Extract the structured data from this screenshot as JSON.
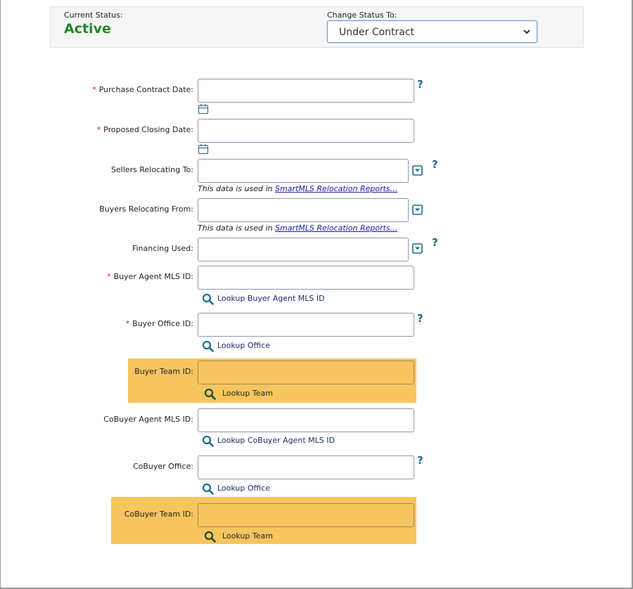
{
  "status": {
    "current_label": "Current Status:",
    "current_value": "Active",
    "change_label": "Change Status To:",
    "change_value": "Under Contract"
  },
  "fields": {
    "purchase_contract_date": {
      "label": "Purchase Contract Date:",
      "required": "*"
    },
    "proposed_closing_date": {
      "label": "Proposed Closing Date:",
      "required": "*"
    },
    "sellers_relocating_to": {
      "label": "Sellers Relocating To:",
      "note_prefix": "This data is used in ",
      "note_link": "SmartMLS Relocation Reports..."
    },
    "buyers_relocating_from": {
      "label": "Buyers Relocating From:",
      "note_prefix": "This data is used in ",
      "note_link": "SmartMLS Relocation Reports..."
    },
    "financing_used": {
      "label": "Financing Used:"
    },
    "buyer_agent_mls_id": {
      "label": "Buyer Agent MLS ID:",
      "required": "*",
      "lookup": "Lookup Buyer Agent MLS ID"
    },
    "buyer_office_id": {
      "label": "Buyer Office ID:",
      "required": "*",
      "lookup": "Lookup Office"
    },
    "buyer_team_id": {
      "label": "Buyer Team ID:",
      "lookup": "Lookup Team"
    },
    "cobuyer_agent_mls_id": {
      "label": "CoBuyer Agent MLS ID:",
      "lookup": "Lookup CoBuyer Agent MLS ID"
    },
    "cobuyer_office": {
      "label": "CoBuyer Office:",
      "lookup": "Lookup Office"
    },
    "cobuyer_team_id": {
      "label": "CoBuyer Team ID:",
      "lookup": "Lookup Team"
    }
  },
  "help_glyph": "?",
  "colors": {
    "active_status": "#1f8a1f",
    "required_star": "#d01b1b",
    "team_highlight": "#f7c55e",
    "help_icon": "#1c6a8a",
    "link": "#1a1aa8"
  }
}
